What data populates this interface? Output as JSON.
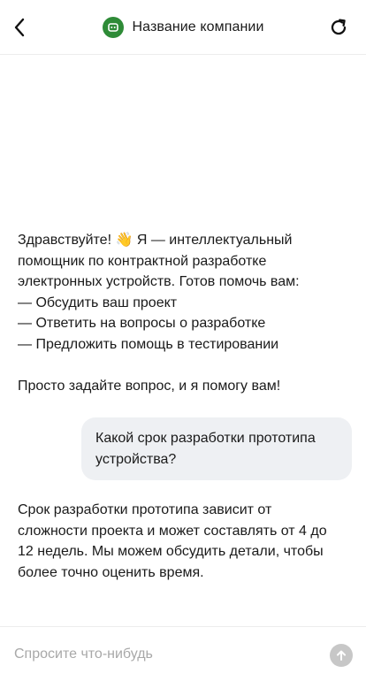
{
  "header": {
    "title": "Название компании",
    "back_icon": "chevron-left-icon",
    "refresh_icon": "refresh-icon",
    "logo_icon": "bot-icon",
    "logo_color": "#2e8b37"
  },
  "messages": [
    {
      "role": "assistant",
      "text": "Здравствуйте! 👋 Я — интеллектуальный\nпомощник по контрактной разработке\nэлектронных устройств. Готов помочь вам:\n— Обсудить ваш проект\n— Ответить на вопросы о разработке\n— Предложить помощь в тестировании\n\nПросто задайте вопрос, и я помогу вам!"
    },
    {
      "role": "user",
      "text": "Какой срок разработки прототипа\nустройства?"
    },
    {
      "role": "assistant",
      "text": "Срок разработки прототипа зависит от\nсложности проекта и может составлять от 4 до\n12 недель. Мы можем обсудить детали, чтобы\nболее точно оценить время."
    }
  ],
  "composer": {
    "placeholder": "Спросите что-нибудь",
    "value": "",
    "send_icon": "arrow-up-icon"
  },
  "colors": {
    "user_bubble": "#eef0f3",
    "send_button_disabled": "#c7c7c7",
    "placeholder": "#a8a8a8"
  }
}
